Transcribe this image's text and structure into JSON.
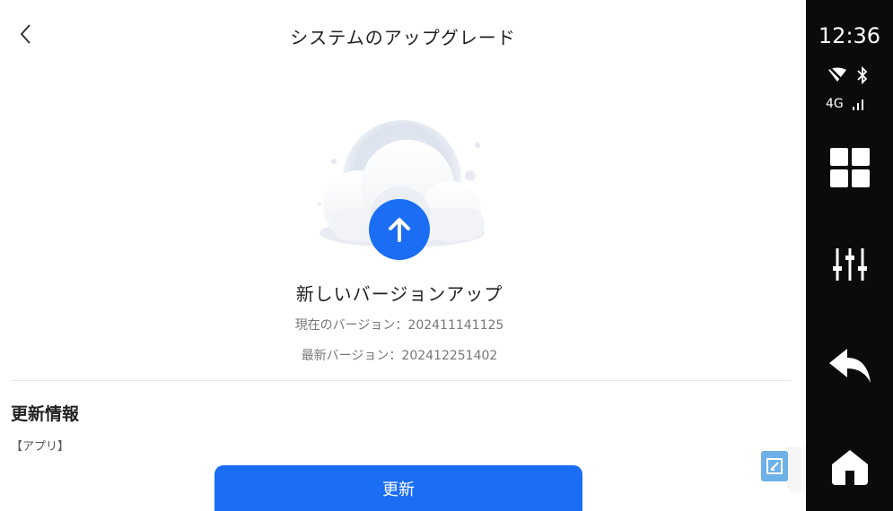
{
  "header": {
    "title": "システムのアップグレード",
    "back_icon": "chevron-left-icon"
  },
  "upgrade": {
    "headline": "新しいバージョンアップ",
    "current_version": "現在のバージョン：202411141125",
    "latest_version": "最新バージョン：202412251402",
    "icon": "upload-arrow-icon"
  },
  "info": {
    "title": "更新情報",
    "subtitle": "【アプリ】"
  },
  "actions": {
    "update_label": "更新"
  },
  "status": {
    "time": "12:36",
    "network": "4G"
  },
  "sidebar": {
    "icons": [
      "apps-grid-icon",
      "equalizer-icon",
      "back-arrow-icon",
      "home-icon"
    ]
  },
  "colors": {
    "accent": "#1b6ef3",
    "sidebar_bg": "#0b0b0b",
    "float_btn": "#6db1e8"
  }
}
